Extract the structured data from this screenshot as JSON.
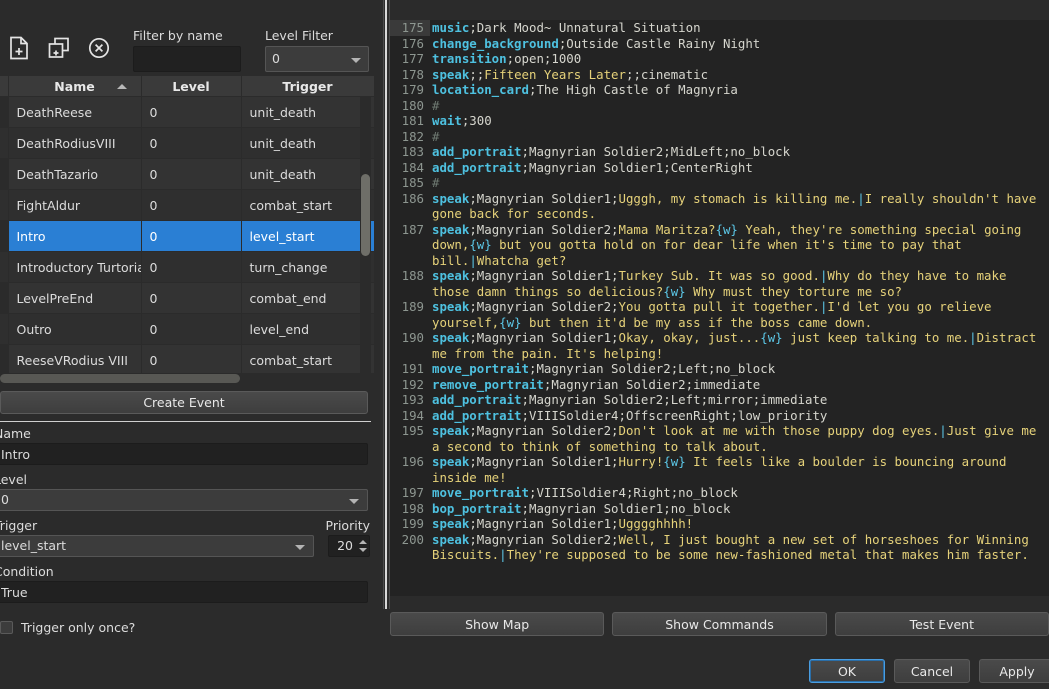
{
  "toolbar": {
    "icons": [
      {
        "name": "new-event-icon",
        "label": "New Event"
      },
      {
        "name": "duplicate-event-icon",
        "label": "Duplicate Event"
      },
      {
        "name": "delete-event-icon",
        "label": "Delete Event"
      }
    ]
  },
  "filters": {
    "name_label": "Filter by name",
    "name_value": "",
    "name_placeholder": "",
    "level_label": "Level Filter",
    "level_value": "0"
  },
  "table": {
    "columns": [
      "Name",
      "Level",
      "Trigger"
    ],
    "sorted_column": "Name",
    "sort_direction": "ascending",
    "rows": [
      {
        "name": "DeathReese",
        "level": "0",
        "trigger": "unit_death"
      },
      {
        "name": "DeathRodiusVIII",
        "level": "0",
        "trigger": "unit_death"
      },
      {
        "name": "DeathTazario",
        "level": "0",
        "trigger": "unit_death"
      },
      {
        "name": "FightAldur",
        "level": "0",
        "trigger": "combat_start"
      },
      {
        "name": "Intro",
        "level": "0",
        "trigger": "level_start"
      },
      {
        "name": "Introductory Turtorial",
        "level": "0",
        "trigger": "turn_change"
      },
      {
        "name": "LevelPreEnd",
        "level": "0",
        "trigger": "combat_end"
      },
      {
        "name": "Outro",
        "level": "0",
        "trigger": "level_end"
      },
      {
        "name": "ReeseVRodius VIII",
        "level": "0",
        "trigger": "combat_start"
      }
    ],
    "selected_row_index": 4
  },
  "create_button_label": "Create Event",
  "form": {
    "name_label": "Name",
    "name_value": "Intro",
    "level_label": "Level",
    "level_value": "0",
    "trigger_label": "Trigger",
    "trigger_value": "level_start",
    "priority_label": "Priority",
    "priority_value": "20",
    "condition_label": "Condition",
    "condition_value": "True",
    "trigger_once_label": "Trigger only once?",
    "trigger_once_checked": false
  },
  "editor": {
    "current_line": 175,
    "lines": [
      {
        "n": 175,
        "tokens": [
          {
            "t": "k",
            "v": "music"
          },
          {
            "t": "p",
            "v": ";Dark Mood~ Unnatural Situation"
          }
        ]
      },
      {
        "n": 176,
        "tokens": [
          {
            "t": "k",
            "v": "change_background"
          },
          {
            "t": "p",
            "v": ";Outside Castle Rainy Night"
          }
        ]
      },
      {
        "n": 177,
        "tokens": [
          {
            "t": "k",
            "v": "transition"
          },
          {
            "t": "p",
            "v": ";open;1000"
          }
        ]
      },
      {
        "n": 178,
        "tokens": [
          {
            "t": "k",
            "v": "speak"
          },
          {
            "t": "p",
            "v": ";;"
          },
          {
            "t": "s",
            "v": "Fifteen Years Later"
          },
          {
            "t": "p",
            "v": ";;cinematic"
          }
        ]
      },
      {
        "n": 179,
        "tokens": [
          {
            "t": "k",
            "v": "location_card"
          },
          {
            "t": "p",
            "v": ";The High Castle of Magnyria"
          }
        ]
      },
      {
        "n": 180,
        "tokens": [
          {
            "t": "c",
            "v": "#"
          }
        ]
      },
      {
        "n": 181,
        "tokens": [
          {
            "t": "k",
            "v": "wait"
          },
          {
            "t": "p",
            "v": ";300"
          }
        ]
      },
      {
        "n": 182,
        "tokens": [
          {
            "t": "c",
            "v": "#"
          }
        ]
      },
      {
        "n": 183,
        "tokens": [
          {
            "t": "k",
            "v": "add_portrait"
          },
          {
            "t": "p",
            "v": ";Magnyrian Soldier2;MidLeft;no_block"
          }
        ]
      },
      {
        "n": 184,
        "tokens": [
          {
            "t": "k",
            "v": "add_portrait"
          },
          {
            "t": "p",
            "v": ";Magnyrian Soldier1;CenterRight"
          }
        ]
      },
      {
        "n": 185,
        "tokens": [
          {
            "t": "c",
            "v": "#"
          }
        ]
      },
      {
        "n": 186,
        "tokens": [
          {
            "t": "k",
            "v": "speak"
          },
          {
            "t": "p",
            "v": ";Magnyrian Soldier1;"
          },
          {
            "t": "s",
            "v": "Ugggh, my stomach is killing me."
          },
          {
            "t": "t",
            "v": "|"
          },
          {
            "t": "s",
            "v": "I really shouldn't have gone back for seconds."
          }
        ]
      },
      {
        "n": 187,
        "tokens": [
          {
            "t": "k",
            "v": "speak"
          },
          {
            "t": "p",
            "v": ";Magnyrian Soldier2;"
          },
          {
            "t": "s",
            "v": "Mama Maritza?"
          },
          {
            "t": "t",
            "v": "{w}"
          },
          {
            "t": "s",
            "v": " Yeah, they're something special going down,"
          },
          {
            "t": "t",
            "v": "{w}"
          },
          {
            "t": "s",
            "v": " but you gotta hold on for dear life when it's time to pay that bill."
          },
          {
            "t": "t",
            "v": "|"
          },
          {
            "t": "s",
            "v": "Whatcha get?"
          }
        ]
      },
      {
        "n": 188,
        "tokens": [
          {
            "t": "k",
            "v": "speak"
          },
          {
            "t": "p",
            "v": ";Magnyrian Soldier1;"
          },
          {
            "t": "s",
            "v": "Turkey Sub. It was so good."
          },
          {
            "t": "t",
            "v": "|"
          },
          {
            "t": "s",
            "v": "Why do they have to make those damn things so delicious?"
          },
          {
            "t": "t",
            "v": "{w}"
          },
          {
            "t": "s",
            "v": " Why must they torture me so?"
          }
        ]
      },
      {
        "n": 189,
        "tokens": [
          {
            "t": "k",
            "v": "speak"
          },
          {
            "t": "p",
            "v": ";Magnyrian Soldier2;"
          },
          {
            "t": "s",
            "v": "You gotta pull it together."
          },
          {
            "t": "t",
            "v": "|"
          },
          {
            "t": "s",
            "v": "I'd let you go relieve yourself,"
          },
          {
            "t": "t",
            "v": "{w}"
          },
          {
            "t": "s",
            "v": " but then it'd be my ass if the boss came down."
          }
        ]
      },
      {
        "n": 190,
        "tokens": [
          {
            "t": "k",
            "v": "speak"
          },
          {
            "t": "p",
            "v": ";Magnyrian Soldier1;"
          },
          {
            "t": "s",
            "v": "Okay, okay, just..."
          },
          {
            "t": "t",
            "v": "{w}"
          },
          {
            "t": "s",
            "v": " just keep talking to me."
          },
          {
            "t": "t",
            "v": "|"
          },
          {
            "t": "s",
            "v": "Distract me from the pain. It's helping!"
          }
        ]
      },
      {
        "n": 191,
        "tokens": [
          {
            "t": "k",
            "v": "move_portrait"
          },
          {
            "t": "p",
            "v": ";Magnyrian Soldier2;Left;no_block"
          }
        ]
      },
      {
        "n": 192,
        "tokens": [
          {
            "t": "k",
            "v": "remove_portrait"
          },
          {
            "t": "p",
            "v": ";Magnyrian Soldier2;immediate"
          }
        ]
      },
      {
        "n": 193,
        "tokens": [
          {
            "t": "k",
            "v": "add_portrait"
          },
          {
            "t": "p",
            "v": ";Magnyrian Soldier2;Left;mirror;immediate"
          }
        ]
      },
      {
        "n": 194,
        "tokens": [
          {
            "t": "k",
            "v": "add_portrait"
          },
          {
            "t": "p",
            "v": ";VIIISoldier4;OffscreenRight;low_priority"
          }
        ]
      },
      {
        "n": 195,
        "tokens": [
          {
            "t": "k",
            "v": "speak"
          },
          {
            "t": "p",
            "v": ";Magnyrian Soldier2;"
          },
          {
            "t": "s",
            "v": "Don't look at me with those puppy dog eyes."
          },
          {
            "t": "t",
            "v": "|"
          },
          {
            "t": "s",
            "v": "Just give me a second to think of something to talk about."
          }
        ]
      },
      {
        "n": 196,
        "tokens": [
          {
            "t": "k",
            "v": "speak"
          },
          {
            "t": "p",
            "v": ";Magnyrian Soldier1;"
          },
          {
            "t": "s",
            "v": "Hurry!"
          },
          {
            "t": "t",
            "v": "{w}"
          },
          {
            "t": "s",
            "v": " It feels like a boulder is bouncing around inside me!"
          }
        ]
      },
      {
        "n": 197,
        "tokens": [
          {
            "t": "k",
            "v": "move_portrait"
          },
          {
            "t": "p",
            "v": ";VIIISoldier4;Right;no_block"
          }
        ]
      },
      {
        "n": 198,
        "tokens": [
          {
            "t": "k",
            "v": "bop_portrait"
          },
          {
            "t": "p",
            "v": ";Magnyrian Soldier1;no_block"
          }
        ]
      },
      {
        "n": 199,
        "tokens": [
          {
            "t": "k",
            "v": "speak"
          },
          {
            "t": "p",
            "v": ";Magnyrian Soldier1;"
          },
          {
            "t": "s",
            "v": "Ugggghhhh!"
          }
        ]
      },
      {
        "n": 200,
        "tokens": [
          {
            "t": "k",
            "v": "speak"
          },
          {
            "t": "p",
            "v": ";Magnyrian Soldier2;"
          },
          {
            "t": "s",
            "v": "Well, I just bought a new set of horseshoes for Winning Biscuits."
          },
          {
            "t": "t",
            "v": "|"
          },
          {
            "t": "s",
            "v": "They're supposed to be some new-fashioned metal that makes him faster."
          }
        ]
      }
    ]
  },
  "actions": {
    "show_map": "Show Map",
    "show_commands": "Show Commands",
    "test_event": "Test Event"
  },
  "dialog": {
    "ok": "OK",
    "cancel": "Cancel",
    "apply": "Apply"
  },
  "colors": {
    "selection_blue": "#2a7fd4",
    "keyword_cyan": "#4ec1e0",
    "string_yellow": "#e6d27a",
    "editor_bg": "#232323",
    "window_bg": "#2b2b2b"
  }
}
